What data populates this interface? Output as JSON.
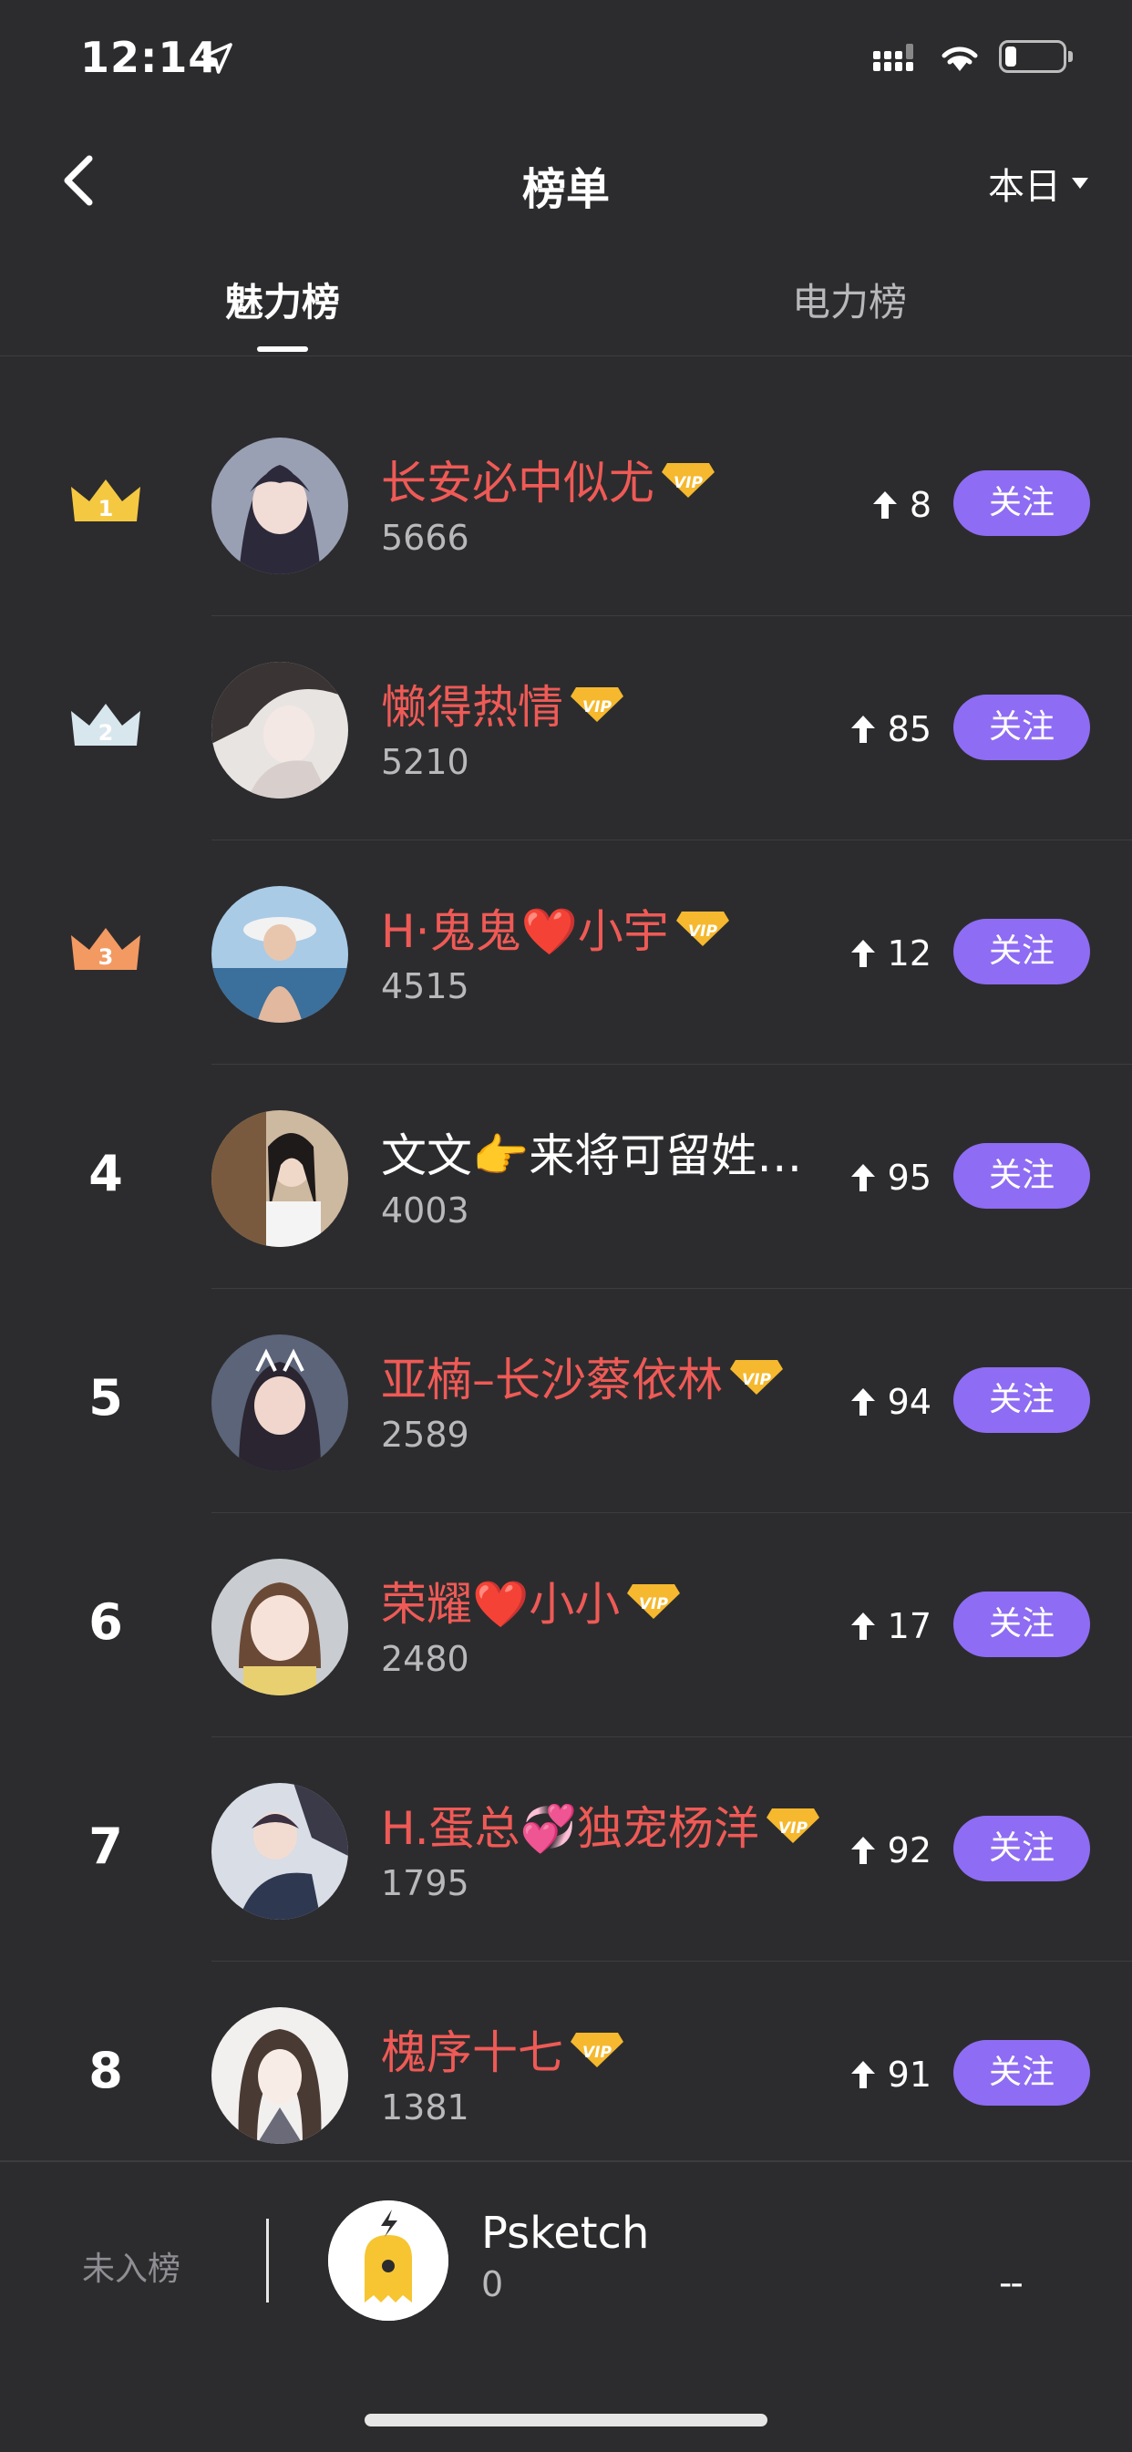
{
  "status_bar": {
    "time": "12:14"
  },
  "nav": {
    "title": "榜单",
    "period": "本日"
  },
  "tabs": [
    {
      "label": "魅力榜"
    },
    {
      "label": "电力榜"
    }
  ],
  "colors": {
    "accent": "#8e6cf3",
    "vip_name": "#ef5a56",
    "gold": "#f5c842",
    "silver": "#d8e6ee",
    "bronze": "#f29a62"
  },
  "ranking": [
    {
      "rank": "1",
      "medal": "gold-crown",
      "name": "长安必中似尤",
      "vip": true,
      "score": "5666",
      "change": "8",
      "follow": "关注"
    },
    {
      "rank": "2",
      "medal": "silver-crown",
      "name": "懒得热情",
      "vip": true,
      "score": "5210",
      "change": "85",
      "follow": "关注"
    },
    {
      "rank": "3",
      "medal": "bronze-crown",
      "name": "H·鬼鬼❤️小宇",
      "vip": true,
      "score": "4515",
      "change": "12",
      "follow": "关注"
    },
    {
      "rank": "4",
      "medal": "",
      "name": "文文👉来将可留姓…",
      "vip": false,
      "score": "4003",
      "change": "95",
      "follow": "关注"
    },
    {
      "rank": "5",
      "medal": "",
      "name": "亚楠–长沙蔡依林",
      "vip": true,
      "score": "2589",
      "change": "94",
      "follow": "关注"
    },
    {
      "rank": "6",
      "medal": "",
      "name": "荣耀❤️小小",
      "vip": true,
      "score": "2480",
      "change": "17",
      "follow": "关注"
    },
    {
      "rank": "7",
      "medal": "",
      "name": "H.蛋总💞独宠杨洋",
      "vip": true,
      "score": "1795",
      "change": "92",
      "follow": "关注"
    },
    {
      "rank": "8",
      "medal": "",
      "name": "槐序十七",
      "vip": true,
      "score": "1381",
      "change": "91",
      "follow": "关注"
    }
  ],
  "me": {
    "status_label": "未入榜",
    "name": "Psketch",
    "score": "0",
    "change": "--"
  },
  "icons": {
    "back": "chevron-left-icon",
    "caret": "caret-down-icon",
    "up": "arrow-up-icon",
    "vip": "vip-badge-icon",
    "location": "location-arrow-icon"
  }
}
